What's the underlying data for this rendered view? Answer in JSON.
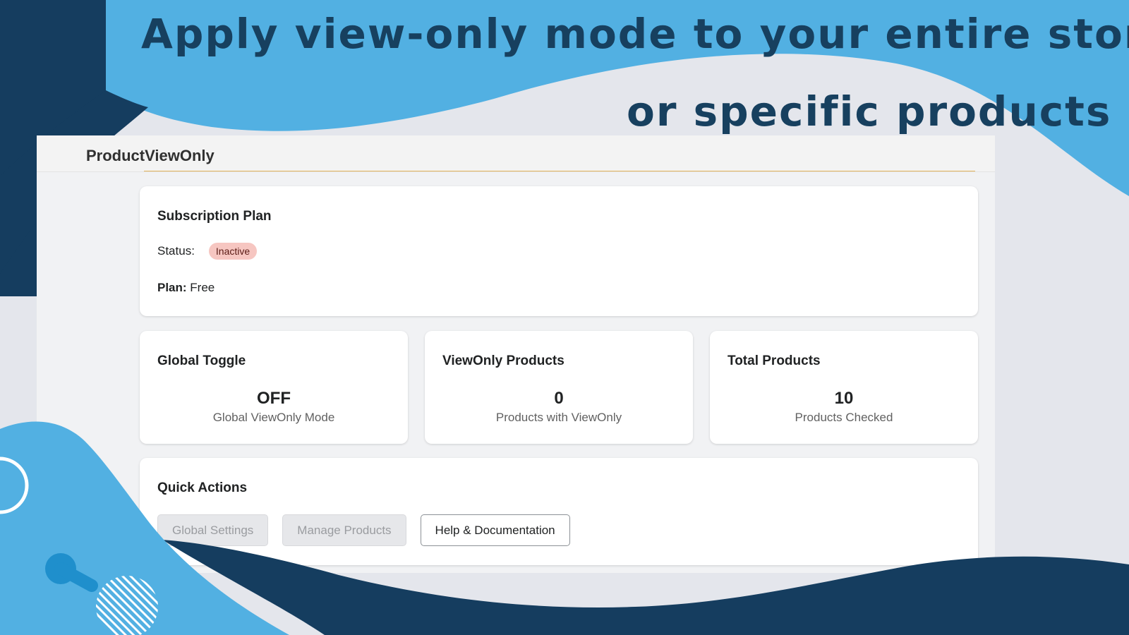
{
  "banner": {
    "headline_line1": "Apply view-only mode to your entire store",
    "headline_line2": "or specific products",
    "colors": {
      "dark_navy": "#153d5f",
      "light_blue": "#52b0e2",
      "text_navy": "#17405f"
    }
  },
  "app": {
    "title": "ProductViewOnly"
  },
  "subscription": {
    "title": "Subscription Plan",
    "status_label": "Status:",
    "status_value": "Inactive",
    "plan_label": "Plan:",
    "plan_value": "Free"
  },
  "stats": [
    {
      "title": "Global Toggle",
      "value": "OFF",
      "caption": "Global ViewOnly Mode"
    },
    {
      "title": "ViewOnly Products",
      "value": "0",
      "caption": "Products with ViewOnly"
    },
    {
      "title": "Total Products",
      "value": "10",
      "caption": "Products Checked"
    }
  ],
  "quick_actions": {
    "title": "Quick Actions",
    "global_settings": "Global Settings",
    "manage_products": "Manage Products",
    "help": "Help & Documentation"
  }
}
